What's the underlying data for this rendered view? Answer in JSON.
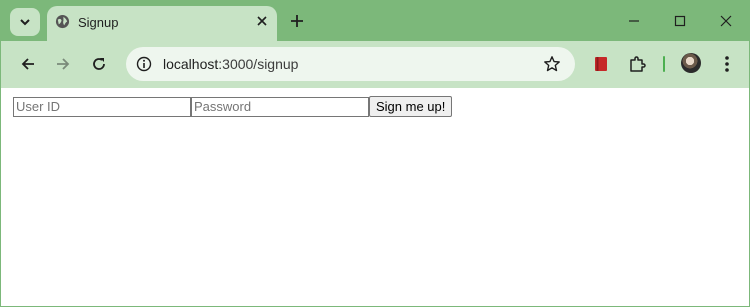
{
  "browser": {
    "tab": {
      "title": "Signup"
    },
    "address_bar": {
      "host": "localhost",
      "path": ":3000/signup"
    },
    "colors": {
      "frame": "#7cb87a",
      "toolbar": "#c7e3c5",
      "omnibox": "#eef6ee",
      "accent": "#4caf50"
    }
  },
  "page": {
    "signup_form": {
      "user_id_placeholder": "User ID",
      "password_placeholder": "Password",
      "submit_label": "Sign me up!"
    }
  },
  "icons": [
    "tab-search-icon",
    "globe-icon",
    "close-icon",
    "plus-icon",
    "minimize-icon",
    "maximize-icon",
    "window-close-icon",
    "back-arrow-icon",
    "forward-arrow-icon",
    "reload-icon",
    "site-info-icon",
    "star-icon",
    "bookmark-extension-icon",
    "puzzle-icon",
    "avatar",
    "kebab-menu-icon"
  ]
}
